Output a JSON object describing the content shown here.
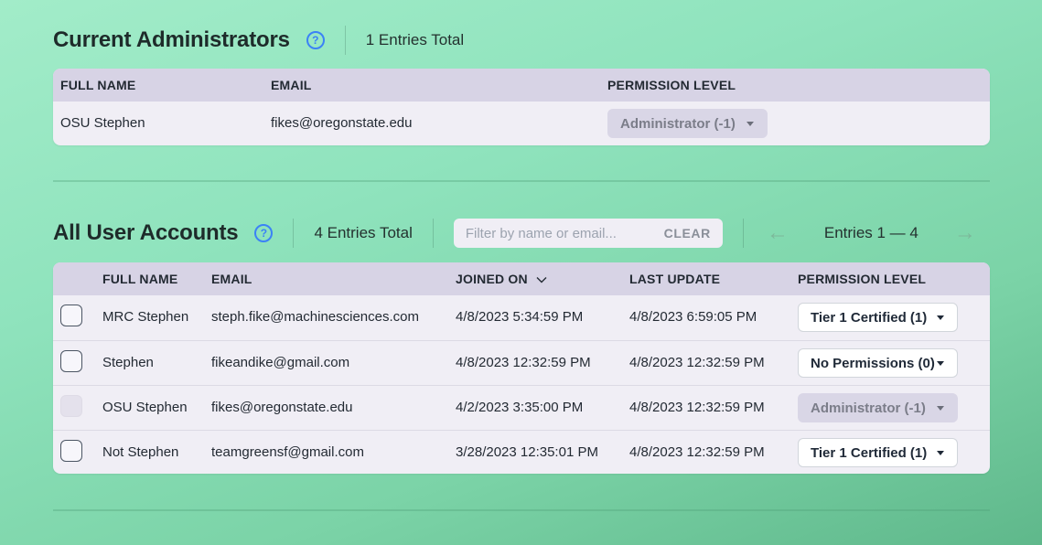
{
  "admins": {
    "title": "Current Administrators",
    "help_icon": "?",
    "entries_total": "1 Entries Total",
    "columns": [
      "FULL NAME",
      "EMAIL",
      "PERMISSION LEVEL"
    ],
    "rows": [
      {
        "name": "OSU Stephen",
        "email": "fikes@oregonstate.edu",
        "permission": "Administrator (-1)"
      }
    ]
  },
  "users": {
    "title": "All User Accounts",
    "help_icon": "?",
    "entries_total": "4 Entries Total",
    "filter_placeholder": "Filter by name or email...",
    "clear_label": "CLEAR",
    "prev_icon": "←",
    "next_icon": "→",
    "pager_label": "Entries 1 — 4",
    "columns": {
      "name": "FULL NAME",
      "email": "EMAIL",
      "joined": "JOINED ON",
      "updated": "LAST UPDATE",
      "permission": "PERMISSION LEVEL"
    },
    "rows": [
      {
        "name": "MRC Stephen",
        "email": "steph.fike@machinesciences.com",
        "joined": "4/8/2023 5:34:59 PM",
        "updated": "4/8/2023 6:59:05 PM",
        "permission": "Tier 1 Certified (1)"
      },
      {
        "name": "Stephen",
        "email": "fikeandike@gmail.com",
        "joined": "4/8/2023 12:32:59 PM",
        "updated": "4/8/2023 12:32:59 PM",
        "permission": "No Permissions (0)"
      },
      {
        "name": "OSU Stephen",
        "email": "fikes@oregonstate.edu",
        "joined": "4/2/2023 3:35:00 PM",
        "updated": "4/8/2023 12:32:59 PM",
        "permission": "Administrator (-1)"
      },
      {
        "name": "Not Stephen",
        "email": "teamgreensf@gmail.com",
        "joined": "3/28/2023 12:35:01 PM",
        "updated": "4/8/2023 12:32:59 PM",
        "permission": "Tier 1 Certified (1)"
      }
    ]
  },
  "colors": {
    "accent": "#3b82f6",
    "table_header": "#d7d3e5",
    "table_body": "#f0eef5",
    "disabled_select": "#d9d6e6"
  }
}
